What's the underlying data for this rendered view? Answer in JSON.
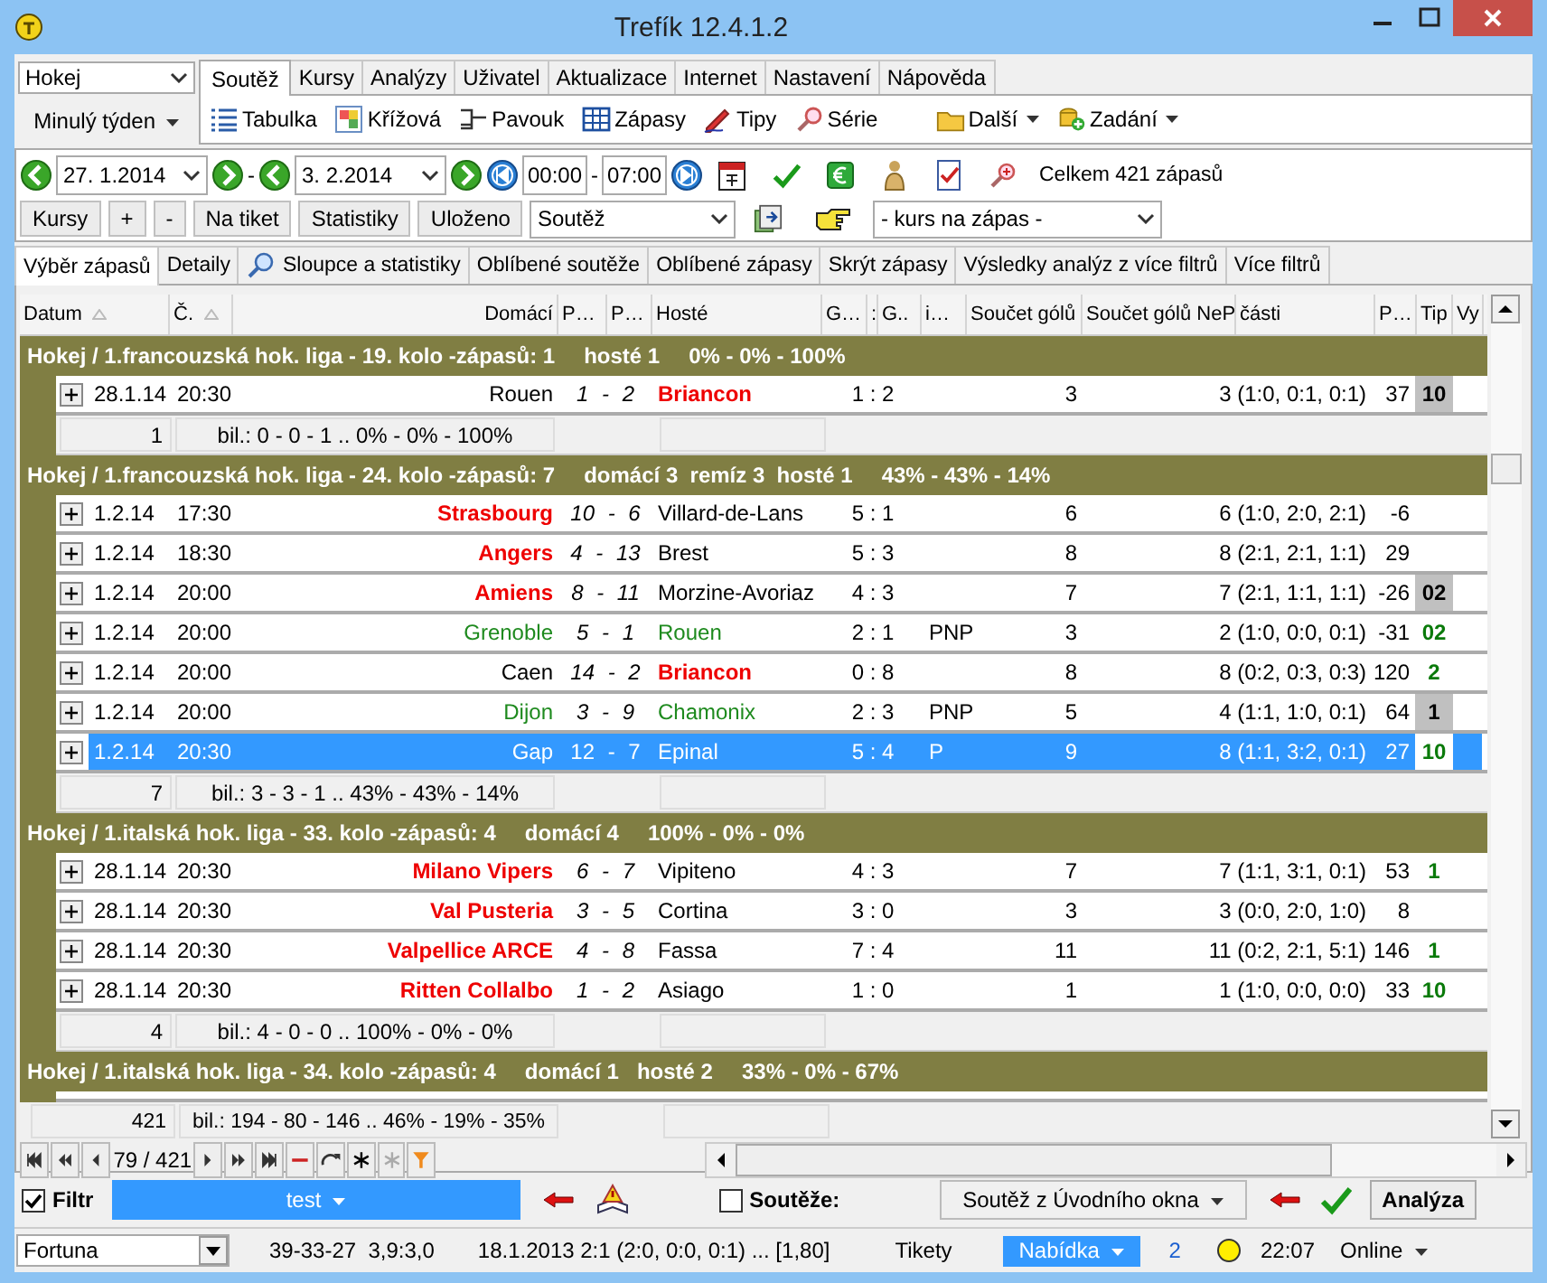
{
  "window": {
    "title": "Trefík 12.4.1.2"
  },
  "sport_select": {
    "value": "Hokej"
  },
  "period_menu": {
    "label": "Minulý týden"
  },
  "menu_tabs": [
    {
      "label": "Soutěž",
      "selected": true
    },
    {
      "label": "Kursy",
      "selected": false
    },
    {
      "label": "Analýzy",
      "selected": false
    },
    {
      "label": "Uživatel",
      "selected": false
    },
    {
      "label": "Aktualizace",
      "selected": false
    },
    {
      "label": "Internet",
      "selected": false
    },
    {
      "label": "Nastavení",
      "selected": false
    },
    {
      "label": "Nápověda",
      "selected": false
    }
  ],
  "ribbon": [
    {
      "label": "Tabulka",
      "kind": "list",
      "dropdown": false
    },
    {
      "label": "Křížová",
      "kind": "grid",
      "dropdown": false
    },
    {
      "label": "Pavouk",
      "kind": "bracket",
      "dropdown": false
    },
    {
      "label": "Zápasy",
      "kind": "table",
      "dropdown": false
    },
    {
      "label": "Tipy",
      "kind": "pencil",
      "dropdown": false
    },
    {
      "label": "Série",
      "kind": "magnifier",
      "dropdown": false
    },
    {
      "label": "Další",
      "kind": "folder",
      "dropdown": true
    },
    {
      "label": "Zadání",
      "kind": "coins",
      "dropdown": true
    }
  ],
  "date_bar": {
    "date_from": "27. 1.2014",
    "separator": "-",
    "date_to": "3. 2.2014",
    "time_from": "00:00",
    "time_separator": "-",
    "time_to": "07:00",
    "total": "Celkem 421 zápasů"
  },
  "action_bar": {
    "buttons": [
      "Kursy",
      "+",
      "-",
      "Na tiket",
      "Statistiky",
      "Uloženo"
    ],
    "competition_select": "Soutěž",
    "odds_select": "- kurs na zápas -"
  },
  "view_tabs": [
    {
      "label": "Výběr zápasů",
      "selected": true,
      "icon": false
    },
    {
      "label": "Detaily",
      "selected": false,
      "icon": false
    },
    {
      "label": "Sloupce a statistiky",
      "selected": false,
      "icon": true
    },
    {
      "label": "Oblíbené soutěže",
      "selected": false,
      "icon": false
    },
    {
      "label": "Oblíbené zápasy",
      "selected": false,
      "icon": false
    },
    {
      "label": "Skrýt zápasy",
      "selected": false,
      "icon": false
    },
    {
      "label": "Výsledky analýz z více filtrů",
      "selected": false,
      "icon": false
    },
    {
      "label": "Více filtrů",
      "selected": false,
      "icon": false
    }
  ],
  "table": {
    "columns": [
      "Datum",
      "Č.",
      "Domácí",
      "P…",
      "P…",
      "Hosté",
      "G…",
      ":",
      "G..",
      "i…",
      "Součet gólů",
      "Součet gólů NeP",
      "části",
      "P…",
      "Tip",
      "Vy"
    ],
    "groups": [
      {
        "title": "Hokej / 1.francouzská hok. liga - 19. kolo -zápasů: 1",
        "outcomes": "hosté 1",
        "percent": "0% - 0% - 100%",
        "rows": [
          {
            "date": "28.1.14",
            "time": "20:30",
            "home": "Rouen",
            "home_won": false,
            "home_tipped": false,
            "score": "1 - 2",
            "away": "Briancon",
            "away_won": true,
            "away_tipped": false,
            "result": "1 : 2",
            "total": "3",
            "parts": "3 (1:0, 0:1, 0:1)",
            "p": "37",
            "tip": "10",
            "tip_boxed": true,
            "selected": false
          }
        ],
        "summary": {
          "count": "1",
          "balance": "bil.: 0 - 0 - 1 .. 0% - 0% - 100%"
        }
      },
      {
        "title": "Hokej / 1.francouzská hok. liga - 24. kolo -zápasů: 7",
        "outcomes": "domácí 3  remíz 3  hosté 1",
        "percent": "43% - 43% - 14%",
        "rows": [
          {
            "date": "1.2.14",
            "time": "17:30",
            "home": "Strasbourg",
            "home_won": true,
            "home_tipped": false,
            "score": "10 - 6",
            "away": "Villard-de-Lans",
            "away_won": false,
            "away_tipped": false,
            "result": "5 : 1",
            "total": "6",
            "parts": "6 (1:0, 2:0, 2:1)",
            "p": "-6",
            "selected": false
          },
          {
            "date": "1.2.14",
            "time": "18:30",
            "home": "Angers",
            "home_won": true,
            "home_tipped": false,
            "score": "4 - 13",
            "away": "Brest",
            "away_won": false,
            "away_tipped": false,
            "result": "5 : 3",
            "total": "8",
            "parts": "8 (2:1, 2:1, 1:1)",
            "p": "29",
            "selected": false
          },
          {
            "date": "1.2.14",
            "time": "20:00",
            "home": "Amiens",
            "home_won": true,
            "home_tipped": false,
            "score": "8 - 11",
            "away": "Morzine-Avoriaz",
            "away_won": false,
            "away_tipped": false,
            "result": "4 : 3",
            "total": "7",
            "parts": "7 (2:1, 1:1, 1:1)",
            "p": "-26",
            "tip": "02",
            "tip_boxed": true,
            "selected": false
          },
          {
            "date": "1.2.14",
            "time": "20:00",
            "home": "Grenoble",
            "home_won": false,
            "home_tipped": true,
            "score": "5 - 1",
            "away": "Rouen",
            "away_won": false,
            "away_tipped": true,
            "result": "2 : 1",
            "extra": "PNP",
            "total": "3",
            "parts": "2 (1:0, 0:0, 0:1)",
            "p": "-31",
            "tip": "02",
            "tip_boxed": false,
            "selected": false
          },
          {
            "date": "1.2.14",
            "time": "20:00",
            "home": "Caen",
            "home_won": false,
            "home_tipped": false,
            "score": "14 - 2",
            "away": "Briancon",
            "away_won": true,
            "away_tipped": false,
            "result": "0 : 8",
            "total": "8",
            "parts": "8 (0:2, 0:3, 0:3)",
            "p": "120",
            "tip": "2",
            "tip_boxed": false,
            "selected": false
          },
          {
            "date": "1.2.14",
            "time": "20:00",
            "home": "Dijon",
            "home_won": false,
            "home_tipped": true,
            "score": "3 - 9",
            "away": "Chamonix",
            "away_won": false,
            "away_tipped": true,
            "result": "2 : 3",
            "extra": "PNP",
            "total": "5",
            "parts": "4 (1:1, 1:0, 0:1)",
            "p": "64",
            "tip": "1",
            "tip_boxed": true,
            "selected": false
          },
          {
            "date": "1.2.14",
            "time": "20:30",
            "home": "Gap",
            "home_won": false,
            "home_tipped": false,
            "score": "12 - 7",
            "away": "Epinal",
            "away_won": false,
            "away_tipped": false,
            "result": "5 : 4",
            "extra": "P",
            "total": "9",
            "parts": "8 (1:1, 3:2, 0:1)",
            "p": "27",
            "tip": "10",
            "tip_boxed": false,
            "selected": true
          }
        ],
        "summary": {
          "count": "7",
          "balance": "bil.: 3 - 3 - 1 .. 43% - 43% - 14%"
        }
      },
      {
        "title": "Hokej / 1.italská hok. liga - 33. kolo -zápasů: 4",
        "outcomes": "domácí 4",
        "percent": "100% - 0% - 0%",
        "rows": [
          {
            "date": "28.1.14",
            "time": "20:30",
            "home": "Milano Vipers",
            "home_won": true,
            "home_tipped": false,
            "score": "6 - 7",
            "away": "Vipiteno",
            "away_won": false,
            "away_tipped": false,
            "result": "4 : 3",
            "total": "7",
            "parts": "7 (1:1, 3:1, 0:1)",
            "p": "53",
            "tip": "1",
            "tip_boxed": false,
            "selected": false
          },
          {
            "date": "28.1.14",
            "time": "20:30",
            "home": "Val Pusteria",
            "home_won": true,
            "home_tipped": false,
            "score": "3 - 5",
            "away": "Cortina",
            "away_won": false,
            "away_tipped": false,
            "result": "3 : 0",
            "total": "3",
            "parts": "3 (0:0, 2:0, 1:0)",
            "p": "8",
            "selected": false
          },
          {
            "date": "28.1.14",
            "time": "20:30",
            "home": "Valpellice ARCE",
            "home_won": true,
            "home_tipped": false,
            "score": "4 - 8",
            "away": "Fassa",
            "away_won": false,
            "away_tipped": false,
            "result": "7 : 4",
            "total": "11",
            "parts": "11 (0:2, 2:1, 5:1)",
            "p": "146",
            "tip": "1",
            "tip_boxed": false,
            "selected": false
          },
          {
            "date": "28.1.14",
            "time": "20:30",
            "home": "Ritten Collalbo",
            "home_won": true,
            "home_tipped": false,
            "score": "1 - 2",
            "away": "Asiago",
            "away_won": false,
            "away_tipped": false,
            "result": "1 : 0",
            "total": "1",
            "parts": "1 (1:0, 0:0, 0:0)",
            "p": "33",
            "tip": "10",
            "tip_boxed": false,
            "selected": false
          }
        ],
        "summary": {
          "count": "4",
          "balance": "bil.: 4 - 0 - 0 .. 100% - 0% - 0%"
        }
      },
      {
        "title": "Hokej / 1.italská hok. liga - 34. kolo -zápasů: 4",
        "outcomes": "domácí 1   hosté 2",
        "percent": "33% - 0% - 67%"
      }
    ],
    "total": {
      "count": "421",
      "balance": "bil.: 194 - 80 - 146 .. 46% - 19% - 35%"
    }
  },
  "navigator": {
    "position": "79 / 421"
  },
  "filter_bar": {
    "filter_checked": true,
    "filter_label": "Filtr",
    "filter_value": "test",
    "competitions_checked": false,
    "competitions_label": "Soutěže:",
    "competitions_value": "Soutěž z Úvodního okna",
    "analyze_button": "Analýza"
  },
  "status_bar": {
    "bookmaker": "Fortuna",
    "record": "39-33-27  3,9:3,0",
    "last_match": "18.1.2013 2:1 (2:0, 0:0, 0:1) ... [1,80]",
    "tickets": "Tikety",
    "offer": "Nabídka",
    "count": "2",
    "time": "22:07",
    "mode": "Online"
  }
}
